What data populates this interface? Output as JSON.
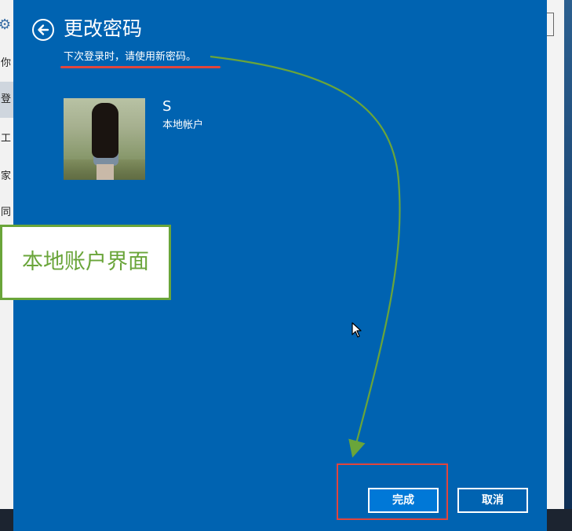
{
  "background": {
    "left_items": [
      {
        "label": "你"
      },
      {
        "label": "登",
        "selected": true
      },
      {
        "label": "工"
      },
      {
        "label": "家"
      },
      {
        "label": "同"
      }
    ]
  },
  "dialog": {
    "title": "更改密码",
    "subtitle": "下次登录时，请使用新密码。",
    "user": {
      "name": "S",
      "account_type": "本地帐户"
    },
    "buttons": {
      "finish": "完成",
      "cancel": "取消"
    }
  },
  "annotation": {
    "callout_text": "本地账户界面"
  },
  "colors": {
    "dialog_bg": "#0063b1",
    "primary_button": "#0078d7",
    "highlight_red": "#e2453c",
    "annotation_green": "#6aa53a"
  },
  "icons": {
    "back": "arrow-left-circle-icon",
    "settings": "gear-icon",
    "cursor": "mouse-pointer-icon"
  }
}
